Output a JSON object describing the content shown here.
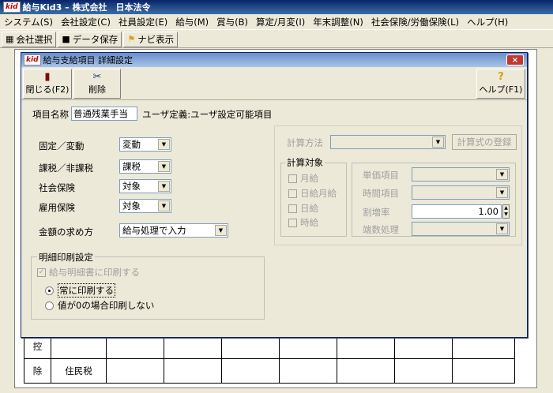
{
  "app": {
    "logo": "kid",
    "title": "給与Kid3 – 株式会社　日本法令"
  },
  "menu": [
    "システム(S)",
    "会社設定(C)",
    "社員設定(E)",
    "給与(M)",
    "賞与(B)",
    "算定/月変(I)",
    "年末調整(N)",
    "社会保険/労働保険(L)",
    "ヘルプ(H)"
  ],
  "toolbar": {
    "company_select": "会社選択",
    "save_data": "データ保存",
    "navi_display": "ナビ表示"
  },
  "background_grid": {
    "side_labels": [
      "控",
      "除"
    ],
    "row_label": "住民税"
  },
  "dialog": {
    "logo": "kid",
    "title": "給与支給項目 詳細設定",
    "close_label": "×",
    "close_button": "閉じる(F2)",
    "delete_button": "削除",
    "help_button": "ヘルプ(F1)",
    "help_mark": "?",
    "item_name_label": "項目名称",
    "item_name_value": "普通残業手当",
    "user_defined_note": "ユーザ定義:ユーザ設定可能項目",
    "fields": [
      {
        "label": "固定／変動",
        "value": "変動"
      },
      {
        "label": "課税／非課税",
        "value": "課税"
      },
      {
        "label": "社会保険",
        "value": "対象"
      },
      {
        "label": "雇用保険",
        "value": "対象"
      }
    ],
    "amount_method_label": "金額の求め方",
    "amount_method_value": "給与処理で入力",
    "print_group": {
      "title": "明細印刷設定",
      "print_on_slip": "給与明細書に印刷する",
      "always_print": "常に印刷する",
      "no_print_if_zero": "値が0の場合印刷しない"
    },
    "calc": {
      "method_label": "計算方法",
      "register_button": "計算式の登録",
      "target_title": "計算対象",
      "targets": [
        "月給",
        "日給月給",
        "日給",
        "時給"
      ],
      "unit_price_label": "単価項目",
      "time_item_label": "時間項目",
      "premium_rate_label": "割増率",
      "premium_rate_value": "1.00",
      "rounding_label": "端数処理"
    }
  }
}
